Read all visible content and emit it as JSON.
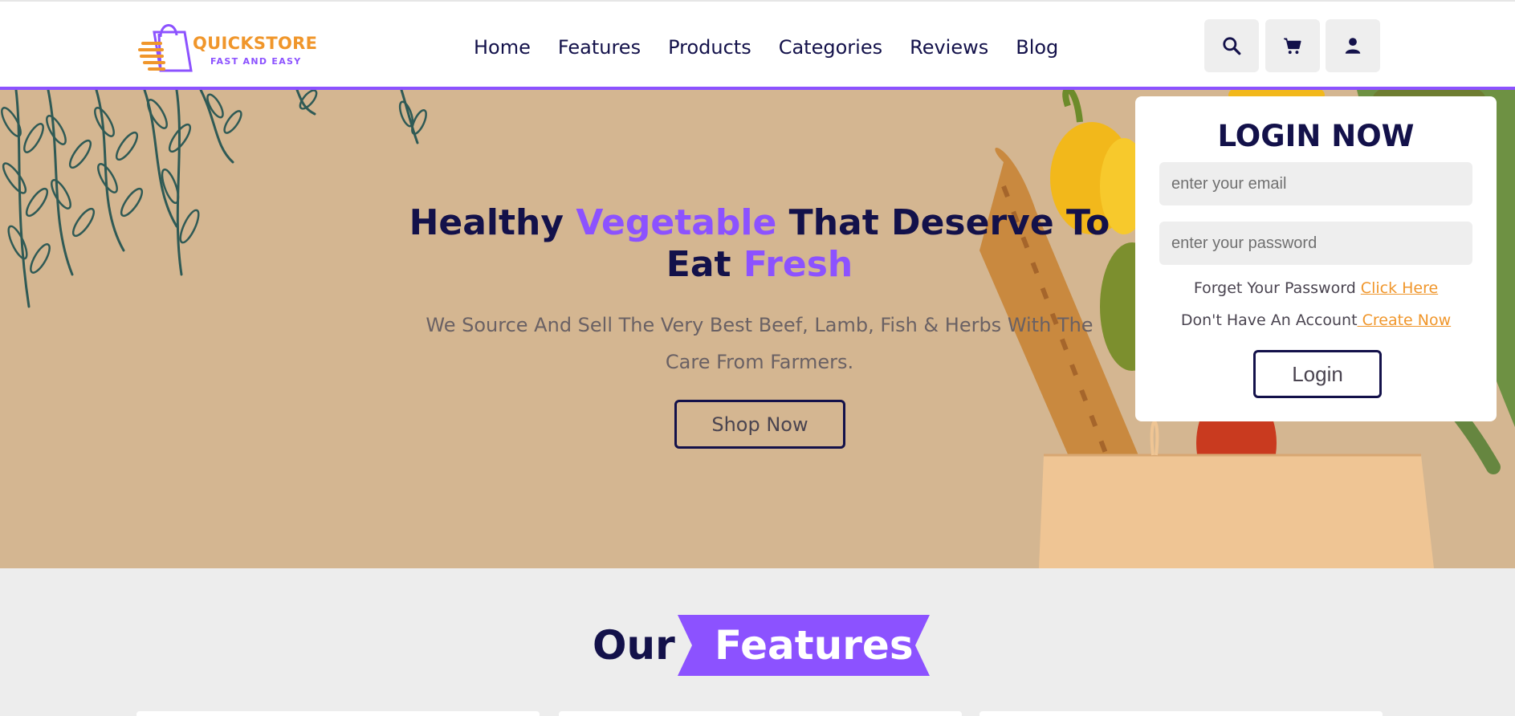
{
  "brand": {
    "name": "QUICKSTORE",
    "tagline": "FAST AND EASY"
  },
  "nav": {
    "items": [
      "Home",
      "Features",
      "Products",
      "Categories",
      "Reviews",
      "Blog"
    ]
  },
  "header_icons": [
    "search-icon",
    "cart-icon",
    "user-icon"
  ],
  "hero": {
    "heading_part1": "Healthy ",
    "heading_accent1": "Vegetable",
    "heading_part2": " That Deserve To Eat ",
    "heading_accent2": "Fresh",
    "text": "We Source And Sell The Very Best Beef, Lamb, Fish & Herbs With The Care From Farmers.",
    "button": "Shop Now"
  },
  "login": {
    "title": "LOGIN NOW",
    "email_placeholder": "enter your email",
    "password_placeholder": "enter your password",
    "forgot_text": "Forget Your Password ",
    "forgot_link": "Click Here",
    "no_account_text": "Don't Have An Account",
    "create_link": " Create Now",
    "button": "Login"
  },
  "features": {
    "title_plain": "Our",
    "title_highlight": "Features"
  },
  "colors": {
    "accent": "#8c52ff",
    "dark": "#13114a",
    "orange": "#f0962b",
    "hero_bg": "#d6b894",
    "section_bg": "#ededed"
  }
}
